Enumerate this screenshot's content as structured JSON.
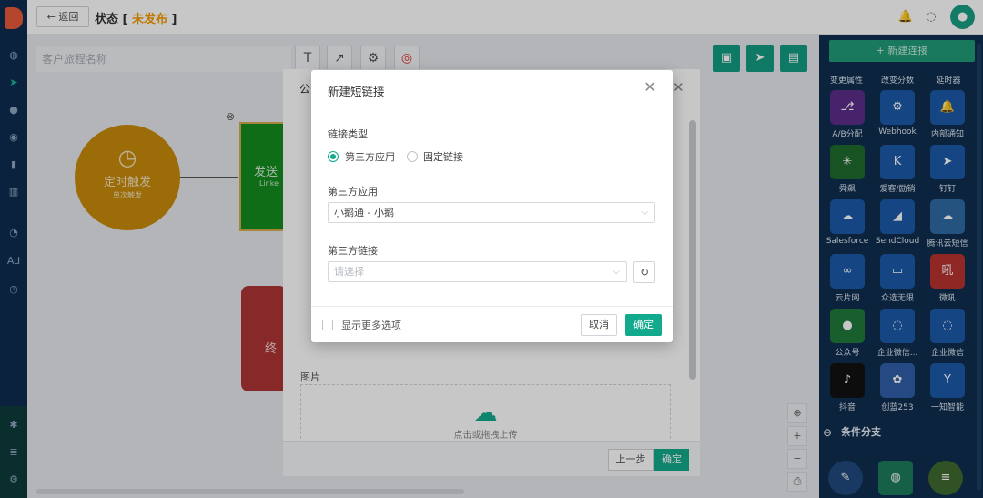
{
  "header": {
    "back_label": "← 返回",
    "status_prefix": "状态 [ ",
    "status_value": "未发布",
    "status_suffix": " ]"
  },
  "canvas": {
    "name_placeholder": "客户旅程名称",
    "timer_node": {
      "title": "定时触发",
      "sub": "单次触发"
    },
    "send_node": {
      "title": "发送",
      "sub": "Linke"
    },
    "end_node": {
      "title": "终"
    }
  },
  "right_panel": {
    "new_connection": "+ 新建连接",
    "top_labels": [
      "变更属性",
      "改变分数",
      "延时器"
    ],
    "rows": [
      [
        "A/B分配",
        "Webhook",
        "内部通知"
      ],
      [
        "舜飙",
        "爱客/励销",
        "钉钉"
      ],
      [
        "Salesforce",
        "SendCloud",
        "腾讯云短信"
      ],
      [
        "云片网",
        "众选无限",
        "微吼"
      ],
      [
        "公众号",
        "企业微信...",
        "企业微信"
      ],
      [
        "抖音",
        "创蓝253",
        "一知智能"
      ]
    ],
    "tile_icons": [
      [
        "ab-split-icon",
        "webhook-icon",
        "bell-icon"
      ],
      [
        "spider-icon",
        "k-icon",
        "dingtalk-icon"
      ],
      [
        "salesforce-icon",
        "sendcloud-icon",
        "cloud-sms-icon"
      ],
      [
        "yunpian-icon",
        "zxwx-icon",
        "weihou-icon"
      ],
      [
        "wechat-icon",
        "wecom-icon",
        "wecom2-icon"
      ],
      [
        "tiktok-icon",
        "chuanglan-icon",
        "yizhi-icon"
      ]
    ],
    "tile_glyphs": [
      [
        "⎇",
        "⚙",
        "🔔"
      ],
      [
        "✳",
        "K",
        "➤"
      ],
      [
        "☁",
        "◢",
        "☁"
      ],
      [
        "∞",
        "▭",
        "吼"
      ],
      [
        "●",
        "◌",
        "◌"
      ],
      [
        "♪",
        "✿",
        "Y"
      ]
    ],
    "branch_label": "条件分支"
  },
  "background_dialog": {
    "title_fragment": "公",
    "image_label": "图片",
    "upload_hint": "点击或拖拽上传",
    "prev_label": "上一步",
    "ok_label": "确定"
  },
  "modal": {
    "title": "新建短链接",
    "link_type_label": "链接类型",
    "radio_third_party": "第三方应用",
    "radio_fixed": "固定链接",
    "app_label": "第三方应用",
    "app_value": "小鹅通 - 小鹅",
    "link_label": "第三方链接",
    "link_placeholder": "请选择",
    "more_options": "显示更多选项",
    "cancel": "取消",
    "confirm": "确定"
  }
}
